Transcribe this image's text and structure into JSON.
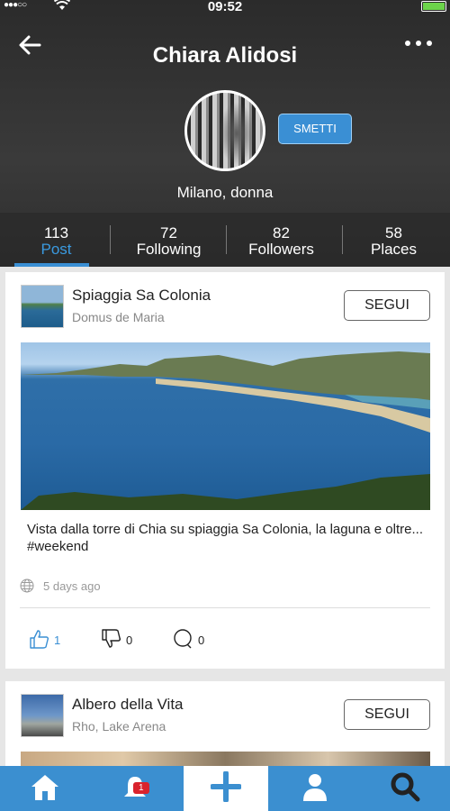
{
  "status_bar": {
    "time": "09:52",
    "signal": "●●●○○"
  },
  "header": {
    "title": "Chiara Alidosi",
    "unfollow_label": "SMETTI",
    "subtitle": "Milano, donna"
  },
  "stats": [
    {
      "count": "113",
      "label": "Post",
      "active": true
    },
    {
      "count": "72",
      "label": "Following"
    },
    {
      "count": "82",
      "label": "Followers"
    },
    {
      "count": "58",
      "label": "Places"
    }
  ],
  "posts": [
    {
      "place_name": "Spiaggia Sa Colonia",
      "place_location": "Domus de Maria",
      "follow_label": "SEGUI",
      "caption": "Vista dalla torre di Chia su spiaggia Sa Colonia, la laguna e oltre... #weekend",
      "time_ago": "5 days ago",
      "likes": "1",
      "dislikes": "0",
      "comments": "0"
    },
    {
      "place_name": "Albero della Vita",
      "place_location": "Rho, Lake Arena",
      "follow_label": "SEGUI"
    }
  ],
  "tabbar": {
    "notification_count": "1"
  },
  "colors": {
    "accent": "#3b8fd0",
    "badge": "#d9232d",
    "header_bg": "#2e2e2e"
  }
}
